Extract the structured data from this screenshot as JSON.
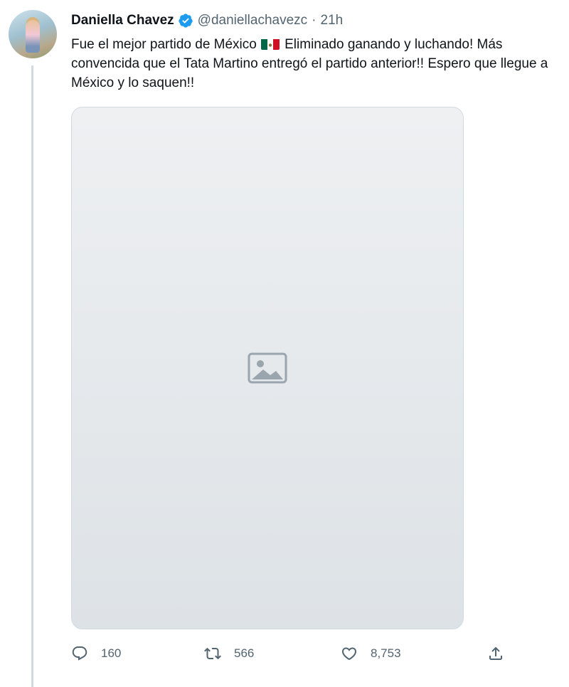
{
  "author": {
    "display_name": "Daniella Chavez",
    "handle": "@daniellachavezc",
    "separator": "·",
    "time": "21h",
    "verified": true
  },
  "tweet": {
    "text_part1": "Fue el mejor partido de México",
    "flag_icon": "mexico-flag-icon",
    "text_part2": " Eliminado ganando y luchando! Más convencida que el Tata Martino entregó el partido anterior!! Espero que llegue a México y lo saquen!!"
  },
  "media": {
    "photo_omitted": true
  },
  "actions": {
    "reply": {
      "icon": "reply-icon",
      "count": "160"
    },
    "retweet": {
      "icon": "retweet-icon",
      "count": "566"
    },
    "like": {
      "icon": "heart-icon",
      "count": "8,753"
    },
    "share": {
      "icon": "share-icon"
    }
  },
  "colors": {
    "verified_blue": "#1d9bf0",
    "secondary_text": "#536471",
    "border": "#cfd9de"
  }
}
